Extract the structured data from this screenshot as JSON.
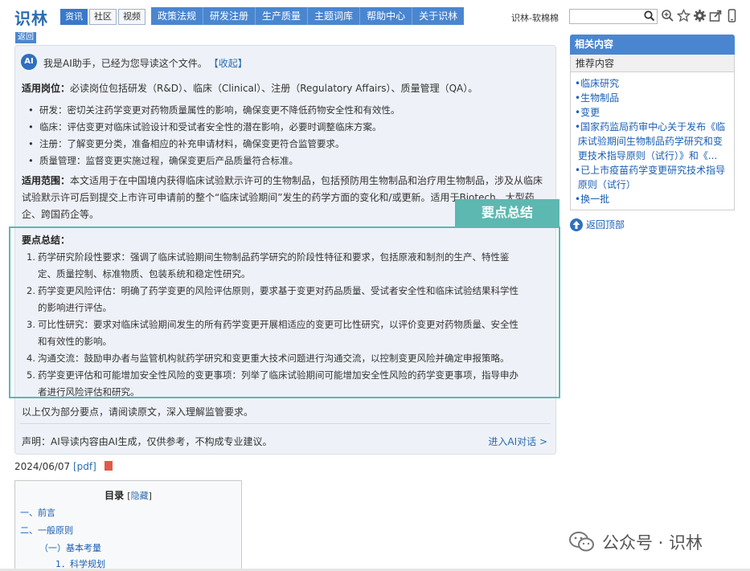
{
  "header": {
    "logo": "识林",
    "site_tabs": [
      "资讯",
      "社区",
      "视频"
    ],
    "nav_items": [
      "政策法规",
      "研发注册",
      "生产质量",
      "主题词库",
      "帮助中心",
      "关于识林"
    ],
    "site_name": "识林-软棉棉",
    "search_placeholder": "",
    "back_label": "返回"
  },
  "ai_panel": {
    "badge": "AI",
    "intro": "我是AI助手，已经为您导读这个文件。",
    "collapse": "【收起】",
    "positions_label": "适用岗位：",
    "positions_text": "必读岗位包括研发（R&D）、临床（Clinical）、注册（Regulatory Affairs）、质量管理（QA）。",
    "bullets": [
      "研发：密切关注药学变更对药物质量属性的影响，确保变更不降低药物安全性和有效性。",
      "临床：评估变更对临床试验设计和受试者安全性的潜在影响，必要时调整临床方案。",
      "注册：了解变更分类，准备相应的补充申请材料，确保变更符合监管要求。",
      "质量管理：监督变更实施过程，确保变更后产品质量符合标准。"
    ],
    "scope_label": "适用范围：",
    "scope_line1": "本文适用于在中国境内获得临床试验默示许可的生物制品，包括预防用生物制品和治疗用生物制品，涉及从临床",
    "scope_line2": "试验默示许可后到提交上市许可申请前的整个“临床试验期间”发生的药学方面的变化和/或更新。适用于Biotech、大型药",
    "scope_line3": "企、跨国药企等。",
    "summary_tag": "要点总结",
    "summary_title": "要点总结：",
    "summary": [
      {
        "num": "1.",
        "lines": [
          "药学研究阶段性要求：强调了临床试验期间生物制品药学研究的阶段性特征和要求，包括原液和制剂的生产、特性鉴",
          "定、质量控制、标准物质、包装系统和稳定性研究。"
        ]
      },
      {
        "num": "2.",
        "lines": [
          "药学变更风险评估：明确了药学变更的风险评估原则，要求基于变更对药品质量、受试者安全性和临床试验结果科学性",
          "的影响进行评估。"
        ]
      },
      {
        "num": "3.",
        "lines": [
          "可比性研究：要求对临床试验期间发生的所有药学变更开展相适应的变更可比性研究，以评价变更对药物质量、安全性",
          "和有效性的影响。"
        ]
      },
      {
        "num": "4.",
        "lines": [
          "沟通交流：鼓励申办者与监管机构就药学研究和变更重大技术问题进行沟通交流，以控制变更风险并确定申报策略。"
        ]
      },
      {
        "num": "5.",
        "lines": [
          "药学变更评估和可能增加安全性风险的变更事项：列举了临床试验期间可能增加安全性风险的药学变更事项，指导申办",
          "者进行风险评估和研究。"
        ]
      }
    ],
    "footer_note": "以上仅为部分要点，请阅读原文，深入理解监管要求。",
    "disclaimer": "声明：AI导读内容由AI生成，仅供参考，不构成专业建议。",
    "enter_ai": "进入AI对话 >"
  },
  "doc": {
    "date": "2024/06/07",
    "pdf_link": "[pdf]"
  },
  "toc": {
    "title": "目录",
    "hide_open": "[",
    "hide_label": "隐藏",
    "hide_close": "]",
    "items": [
      "一、前言",
      "二、一般原则",
      "（一）基本考量",
      "1．科学规划"
    ]
  },
  "sidebar": {
    "header": "相关内容",
    "sub": "推荐内容",
    "items": [
      [
        "临床研究"
      ],
      [
        "生物制品"
      ],
      [
        "变更"
      ],
      [
        "国家药监局药审中心关于发布《临",
        "床试验期间生物制品药学研究和变",
        "更技术指导原则（试行）》和《..."
      ],
      [
        "已上市疫苗药学变更研究技术指导",
        "原则（试行）"
      ],
      [
        "换一批"
      ]
    ],
    "back_top": "返回顶部"
  },
  "watermark": {
    "text": "公众号 · 识林"
  },
  "colors": {
    "brand_blue": "#4a86d0",
    "link_blue": "#1a5fb4",
    "summary_teal": "#5cb8b0",
    "panel_bg": "#eef2f8"
  },
  "icons": [
    "search-icon",
    "zoom-icon",
    "star-icon",
    "gear-icon",
    "share-icon",
    "mobile-icon",
    "pdf-icon",
    "up-arrow-icon",
    "wechat-icon"
  ]
}
